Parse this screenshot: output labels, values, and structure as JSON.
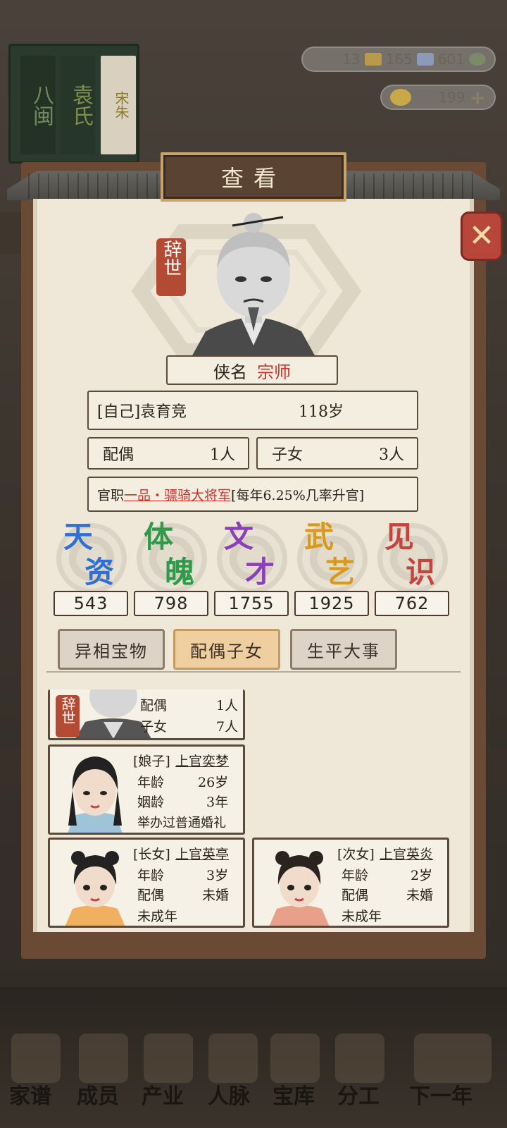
{
  "background": {
    "book_titles": [
      "八闽",
      "袁氏",
      "宋朱"
    ],
    "resources": [
      "13",
      "165",
      "601"
    ],
    "gold": "199",
    "nav": [
      "家谱",
      "成员",
      "产业",
      "人脉",
      "宝库",
      "分工",
      "下一年"
    ]
  },
  "dialog": {
    "title": "查看",
    "deceased_badge": "辞世",
    "title_label": "侠名",
    "title_value": "宗师",
    "self_prefix": "[自己]",
    "self_name": "袁育竞",
    "self_age": "118岁",
    "spouse_label": "配偶",
    "spouse_count": "1人",
    "children_label": "子女",
    "children_count": "3人",
    "official_label": "官职",
    "official_value": "一品・骠骑大将军",
    "official_note": "[每年6.25%几率升官]",
    "stats": [
      {
        "c1": "天",
        "c2": "资",
        "value": "543",
        "color": "#2f6fd6"
      },
      {
        "c1": "体",
        "c2": "魄",
        "value": "798",
        "color": "#2f9a4a"
      },
      {
        "c1": "文",
        "c2": "才",
        "value": "1755",
        "color": "#8b3fb8"
      },
      {
        "c1": "武",
        "c2": "艺",
        "value": "1925",
        "color": "#d99a1c"
      },
      {
        "c1": "见",
        "c2": "识",
        "value": "762",
        "color": "#c9433e"
      }
    ],
    "tabs": [
      "异相宝物",
      "配偶子女",
      "生平大事"
    ],
    "active_tab": 1
  },
  "family": {
    "self_card": {
      "badge": "辞世",
      "spouse_label": "配偶",
      "spouse_value": "1人",
      "children_label": "子女",
      "children_value": "7人"
    },
    "wife": {
      "role": "[娘子]",
      "name": "上官奕梦",
      "age_label": "年龄",
      "age": "26岁",
      "marriage_label": "姻龄",
      "marriage": "3年",
      "note": "举办过普通婚礼"
    },
    "daughter1": {
      "role": "[长女]",
      "name": "上官英亭",
      "age_label": "年龄",
      "age": "3岁",
      "spouse_label": "配偶",
      "spouse": "未婚",
      "note": "未成年"
    },
    "daughter2": {
      "role": "[次女]",
      "name": "上官英炎",
      "age_label": "年龄",
      "age": "2岁",
      "spouse_label": "配偶",
      "spouse": "未婚",
      "note": "未成年"
    }
  }
}
